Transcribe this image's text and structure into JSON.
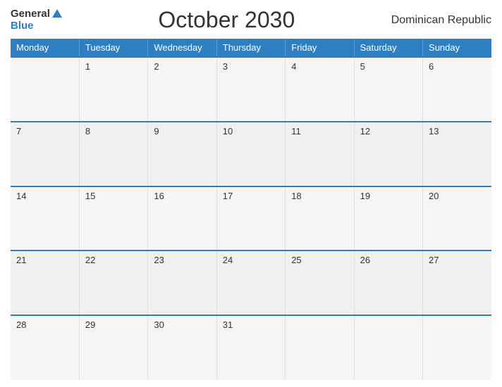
{
  "header": {
    "logo_general": "General",
    "logo_blue": "Blue",
    "title": "October 2030",
    "country": "Dominican Republic"
  },
  "days": [
    "Monday",
    "Tuesday",
    "Wednesday",
    "Thursday",
    "Friday",
    "Saturday",
    "Sunday"
  ],
  "weeks": [
    [
      "",
      "1",
      "2",
      "3",
      "4",
      "5",
      "6"
    ],
    [
      "7",
      "8",
      "9",
      "10",
      "11",
      "12",
      "13"
    ],
    [
      "14",
      "15",
      "16",
      "17",
      "18",
      "19",
      "20"
    ],
    [
      "21",
      "22",
      "23",
      "24",
      "25",
      "26",
      "27"
    ],
    [
      "28",
      "29",
      "30",
      "31",
      "",
      "",
      ""
    ]
  ]
}
